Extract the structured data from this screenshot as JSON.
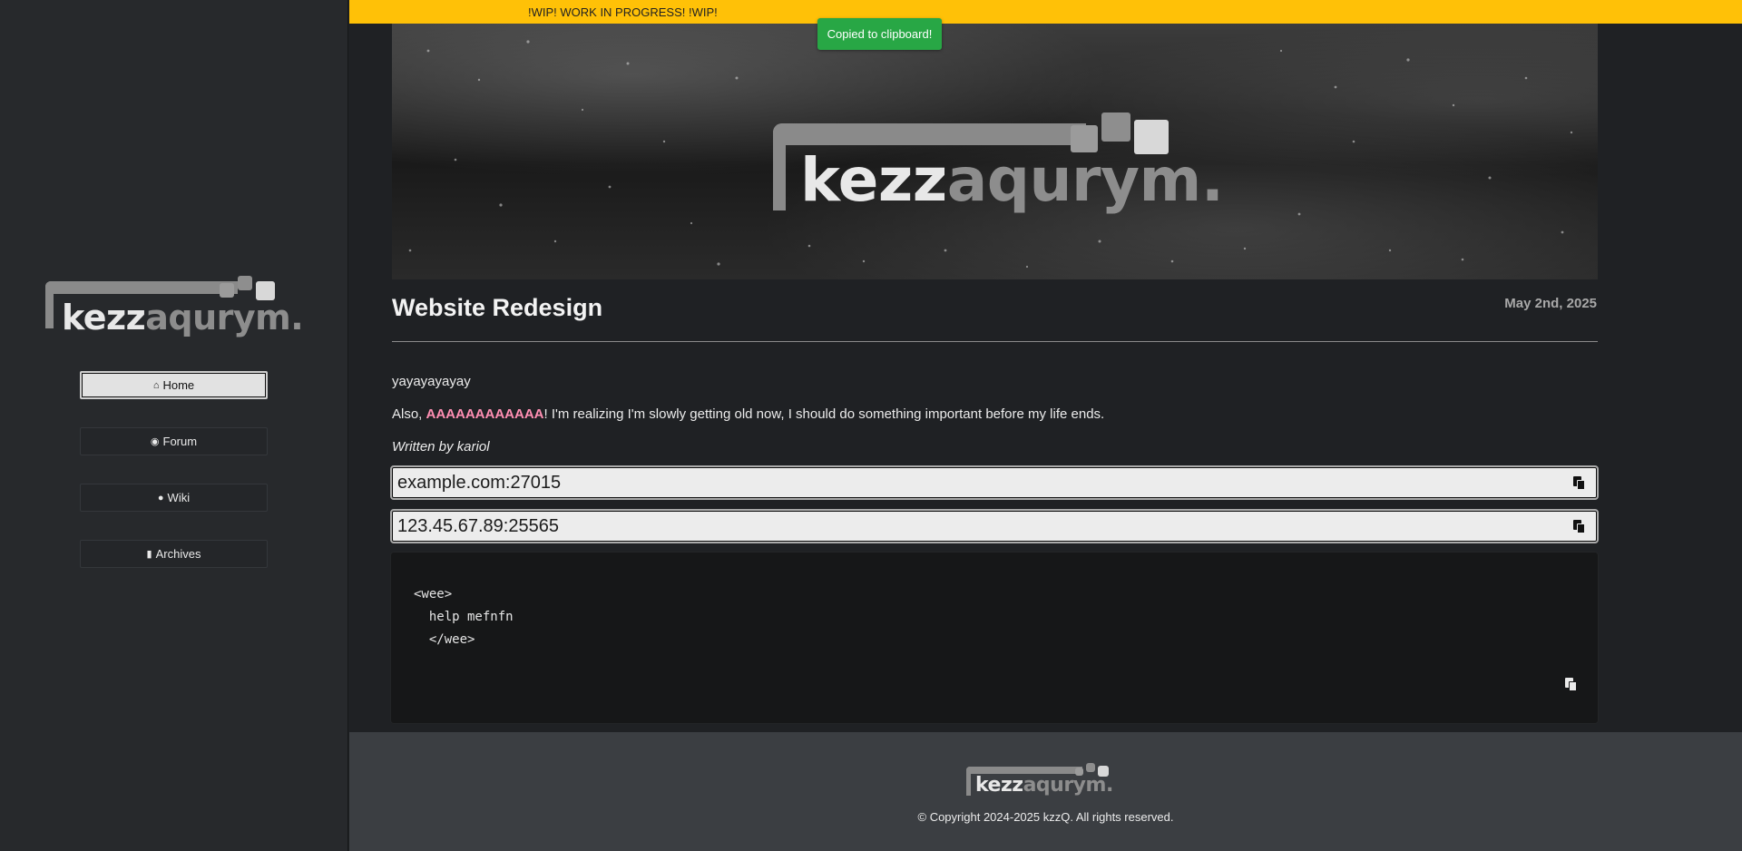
{
  "brand": {
    "logo_part1": "kezz",
    "logo_part2": "aqurym."
  },
  "sidebar": {
    "items": [
      {
        "label": "Home",
        "icon": "home-icon",
        "active": true
      },
      {
        "label": "Forum",
        "icon": "comments-icon",
        "active": false
      },
      {
        "label": "Wiki",
        "icon": "globe-icon",
        "active": false
      },
      {
        "label": "Archives",
        "icon": "book-icon",
        "active": false
      }
    ]
  },
  "banner": {
    "text": "!WIP! WORK IN PROGRESS! !WIP!"
  },
  "toast": {
    "text": "Copied to clipboard!"
  },
  "post": {
    "title": "Website Redesign",
    "date": "May 2nd, 2025",
    "paragraph1": "yayayayayay",
    "paragraph2_prefix": "Also, ",
    "paragraph2_highlight": "AAAAAAAAAAAA",
    "paragraph2_suffix": "! I'm realizing I'm slowly getting old now, I should do something important before my life ends.",
    "author_line": "Written by kariol",
    "copy_fields": [
      {
        "value": "example.com:27015"
      },
      {
        "value": "123.45.67.89:25565"
      }
    ],
    "code": "<wee>\n  help mefnfn\n  </wee>"
  },
  "footer": {
    "copyright": "© Copyright 2024-2025 kzzQ. All rights reserved."
  },
  "colors": {
    "accent_banner": "#ffc107",
    "toast": "#28a745",
    "highlight": "#ff8fb3"
  }
}
